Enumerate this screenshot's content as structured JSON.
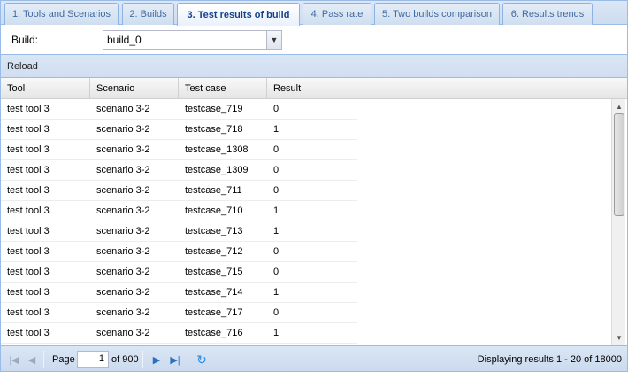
{
  "tabs": [
    {
      "label": "1. Tools and Scenarios"
    },
    {
      "label": "2. Builds"
    },
    {
      "label": "3. Test results of build",
      "active": true
    },
    {
      "label": "4. Pass rate"
    },
    {
      "label": "5. Two builds comparison"
    },
    {
      "label": "6. Results trends"
    }
  ],
  "build": {
    "label": "Build:",
    "value": "build_0"
  },
  "toolbar": {
    "reload_label": "Reload"
  },
  "grid": {
    "columns": [
      "Tool",
      "Scenario",
      "Test case",
      "Result"
    ],
    "rows": [
      [
        "test tool 3",
        "scenario 3-2",
        "testcase_719",
        "0"
      ],
      [
        "test tool 3",
        "scenario 3-2",
        "testcase_718",
        "1"
      ],
      [
        "test tool 3",
        "scenario 3-2",
        "testcase_1308",
        "0"
      ],
      [
        "test tool 3",
        "scenario 3-2",
        "testcase_1309",
        "0"
      ],
      [
        "test tool 3",
        "scenario 3-2",
        "testcase_711",
        "0"
      ],
      [
        "test tool 3",
        "scenario 3-2",
        "testcase_710",
        "1"
      ],
      [
        "test tool 3",
        "scenario 3-2",
        "testcase_713",
        "1"
      ],
      [
        "test tool 3",
        "scenario 3-2",
        "testcase_712",
        "0"
      ],
      [
        "test tool 3",
        "scenario 3-2",
        "testcase_715",
        "0"
      ],
      [
        "test tool 3",
        "scenario 3-2",
        "testcase_714",
        "1"
      ],
      [
        "test tool 3",
        "scenario 3-2",
        "testcase_717",
        "0"
      ],
      [
        "test tool 3",
        "scenario 3-2",
        "testcase_716",
        "1"
      ]
    ]
  },
  "paging": {
    "page_label": "Page",
    "current_page": "1",
    "of_label": "of 900",
    "display_text": "Displaying results 1 - 20 of 18000"
  },
  "colors": {
    "accent": "#15428b",
    "border": "#99bbe8"
  }
}
